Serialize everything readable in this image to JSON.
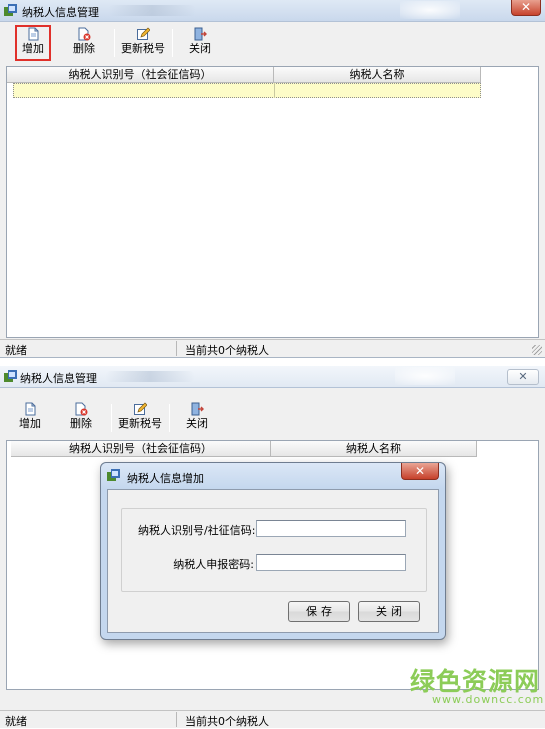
{
  "window": {
    "title": "纳税人信息管理"
  },
  "toolbar": {
    "add_label": "增加",
    "delete_label": "删除",
    "update_label": "更新税号",
    "close_label": "关闭"
  },
  "grid": {
    "columns": [
      "纳税人识别号（社会征信码）",
      "纳税人名称"
    ]
  },
  "status": {
    "left": "就绪",
    "right": "当前共0个纳税人"
  },
  "window2": {
    "close_glyph": "✕"
  },
  "dialog": {
    "title": "纳税人信息增加",
    "close_glyph": "✕",
    "id_label": "纳税人识别号/社征信码:",
    "id_value": "",
    "password_label": "纳税人申报密码:",
    "password_value": "",
    "save_label": "保存",
    "close_label": "关闭"
  },
  "watermark": {
    "main": "绿色资源网",
    "sub": "www.downcc.com",
    "color": "#8ccc58"
  },
  "colors": {
    "highlight": "#e0302a",
    "selected_row": "#fdfcc8",
    "title_close": "#c7432c"
  },
  "window1": {
    "close_glyph": "✕"
  }
}
